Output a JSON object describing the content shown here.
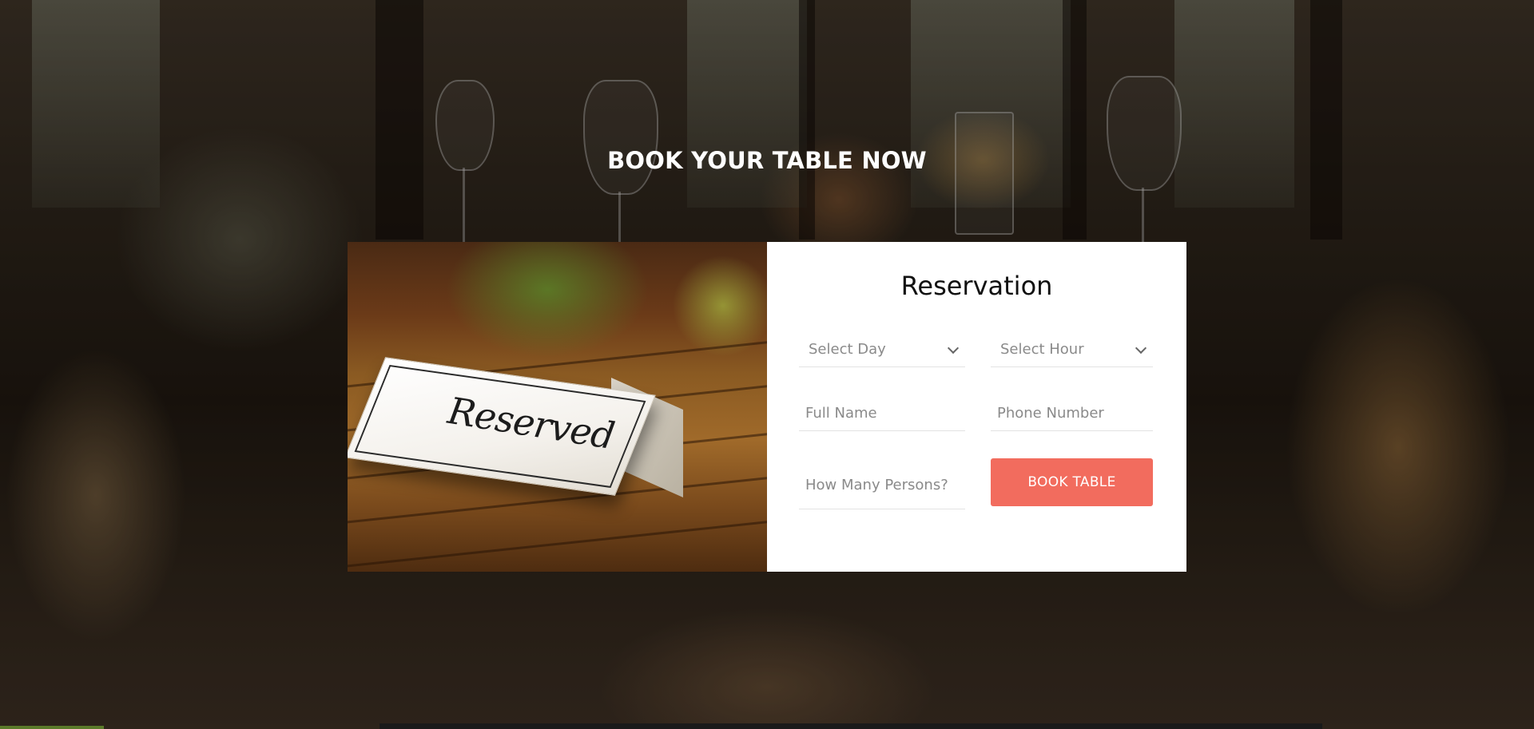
{
  "section": {
    "heading": "BOOK YOUR TABLE NOW"
  },
  "photo": {
    "card_text": "Reserved"
  },
  "form": {
    "title": "Reservation",
    "select_day": "Select Day",
    "select_hour": "Select Hour",
    "full_name_placeholder": "Full Name",
    "phone_placeholder": "Phone Number",
    "persons_placeholder": "How Many Persons?",
    "submit_label": "BOOK TABLE"
  },
  "colors": {
    "accent": "#f26c5e",
    "card_background": "#ffffff",
    "heading_text": "#ffffff"
  }
}
